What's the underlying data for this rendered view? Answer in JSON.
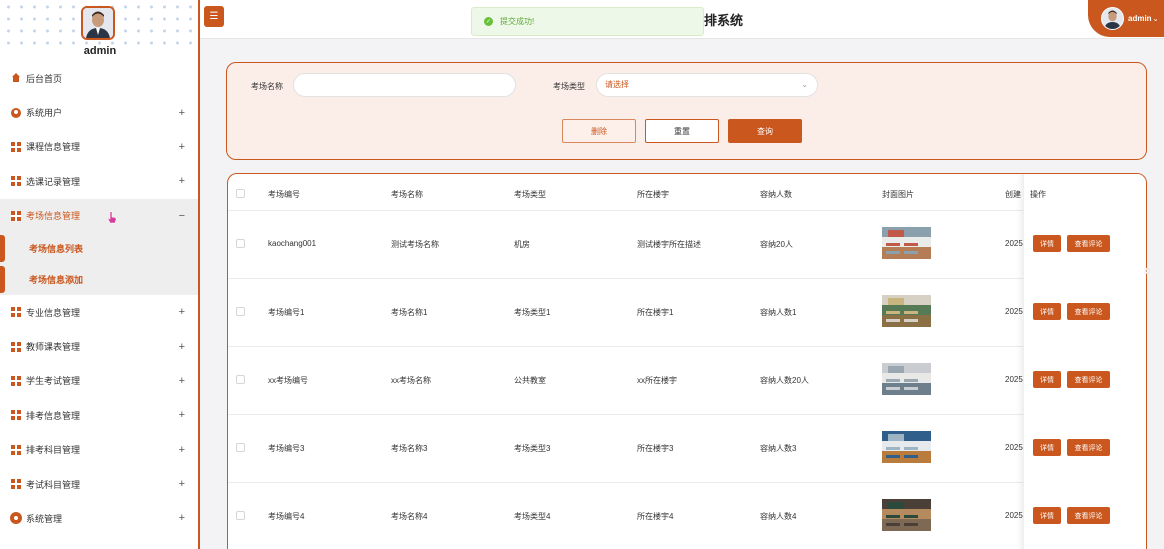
{
  "sidebar": {
    "username": "admin",
    "menu": [
      {
        "label": "后台首页",
        "icon": "home-icon",
        "expandable": false
      },
      {
        "label": "系统用户",
        "icon": "user-icon",
        "expandable": true,
        "toggle": "+"
      },
      {
        "label": "课程信息管理",
        "icon": "grid-icon",
        "expandable": true,
        "toggle": "+"
      },
      {
        "label": "选课记录管理",
        "icon": "grid-icon",
        "expandable": true,
        "toggle": "+"
      },
      {
        "label": "考场信息管理",
        "icon": "grid-icon",
        "expandable": true,
        "toggle": "−",
        "active": true,
        "children": [
          {
            "label": "考场信息列表"
          },
          {
            "label": "考场信息添加"
          }
        ]
      },
      {
        "label": "专业信息管理",
        "icon": "grid-icon",
        "expandable": true,
        "toggle": "+"
      },
      {
        "label": "教师课表管理",
        "icon": "grid-icon",
        "expandable": true,
        "toggle": "+"
      },
      {
        "label": "学生考试管理",
        "icon": "grid-icon",
        "expandable": true,
        "toggle": "+"
      },
      {
        "label": "排考信息管理",
        "icon": "grid-icon",
        "expandable": true,
        "toggle": "+"
      },
      {
        "label": "排考科目管理",
        "icon": "grid-icon",
        "expandable": true,
        "toggle": "+"
      },
      {
        "label": "考试科目管理",
        "icon": "grid-icon",
        "expandable": true,
        "toggle": "+"
      },
      {
        "label": "系统管理",
        "icon": "gear-icon",
        "expandable": true,
        "toggle": "+"
      }
    ]
  },
  "header": {
    "title": "排系统",
    "user": "admin",
    "toggle_glyph": "☰"
  },
  "toast": {
    "message": "提交成功!"
  },
  "search": {
    "name_label": "考场名称",
    "name_value": "",
    "type_label": "考场类型",
    "type_placeholder": "请选择",
    "delete_label": "删除",
    "reset_label": "重置",
    "query_label": "查询"
  },
  "table": {
    "columns": [
      "考场编号",
      "考场名称",
      "考场类型",
      "所在楼宇",
      "容纳人数",
      "封面图片",
      "创建",
      "操作"
    ],
    "rows": [
      {
        "code": "kaochang001",
        "name": "测试考场名称",
        "type": "机房",
        "building": "测试楼宇所在描述",
        "capacity": "容纳20人",
        "created": "2025"
      },
      {
        "code": "考场编号1",
        "name": "考场名称1",
        "type": "考场类型1",
        "building": "所在楼宇1",
        "capacity": "容纳人数1",
        "created": "2025"
      },
      {
        "code": "xx考场编号",
        "name": "xx考场名称",
        "type": "公共教室",
        "building": "xx所在楼宇",
        "capacity": "容纳人数20人",
        "created": "2025"
      },
      {
        "code": "考场编号3",
        "name": "考场名称3",
        "type": "考场类型3",
        "building": "所在楼宇3",
        "capacity": "容纳人数3",
        "created": "2025"
      },
      {
        "code": "考场编号4",
        "name": "考场名称4",
        "type": "考场类型4",
        "building": "所在楼宇4",
        "capacity": "容纳人数4",
        "created": "2025"
      }
    ],
    "detail_label": "详情",
    "review_label": "查看评论"
  },
  "colors": {
    "accent": "#c9571e",
    "success": "#67c23a"
  }
}
